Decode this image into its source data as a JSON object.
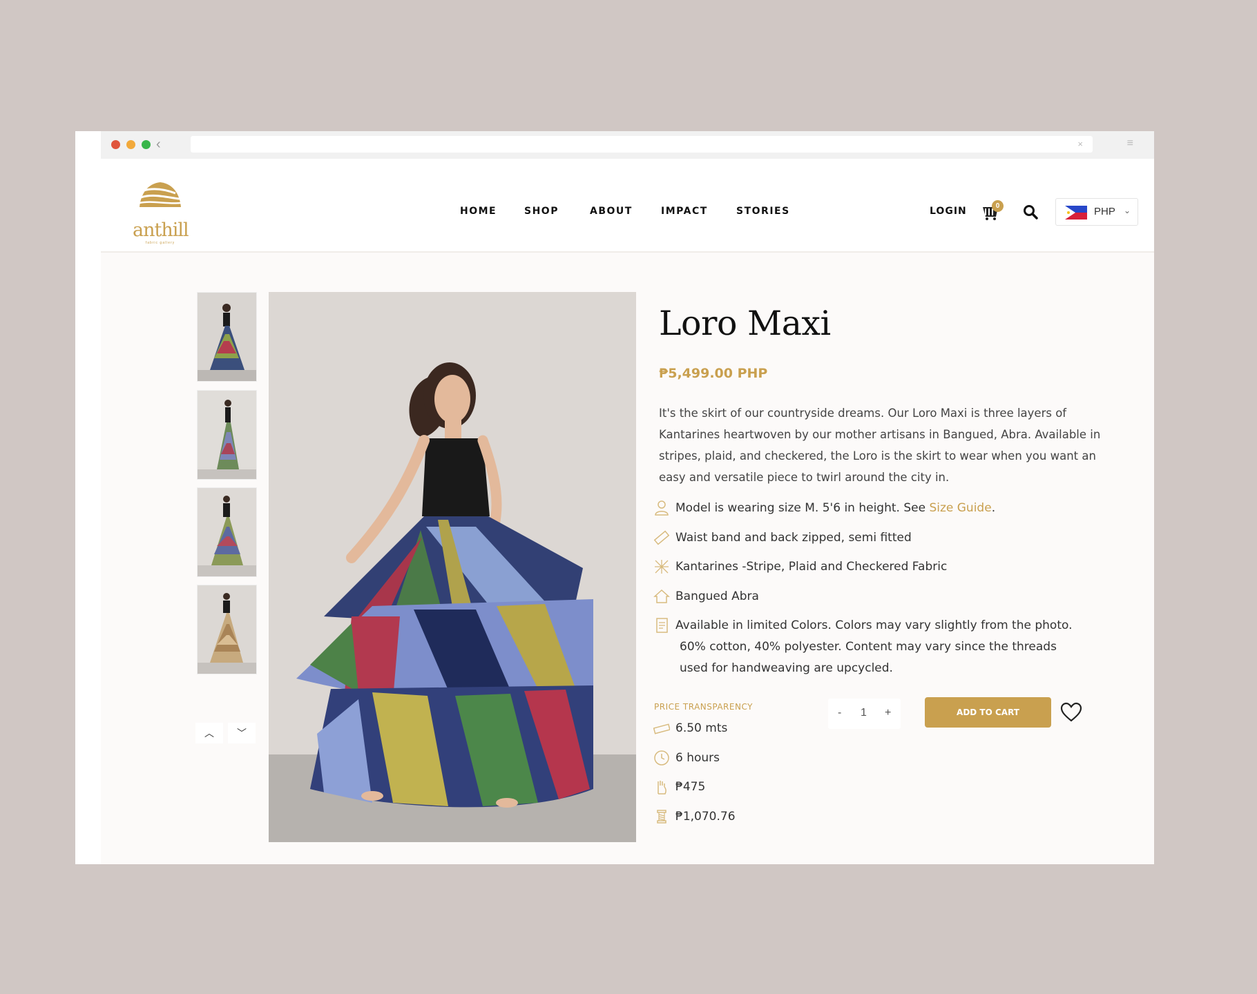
{
  "browser": {
    "back_glyph": "‹",
    "close_glyph": "×",
    "menu_glyph": "≡"
  },
  "brand": {
    "logo_text": "anthill",
    "logo_sub": "fabric gallery",
    "accent_color": "#c9a04f"
  },
  "nav": {
    "items": [
      "HOME",
      "SHOP",
      "ABOUT",
      "IMPACT",
      "STORIES"
    ],
    "login": "LOGIN",
    "cart_count": "0",
    "currency": "PHP",
    "caret": "⌄"
  },
  "gallery": {
    "thumbnail_count": 4,
    "up_glyph": "︿",
    "down_glyph": "﹀"
  },
  "product": {
    "title": "Loro Maxi",
    "price": "₱5,499.00 PHP",
    "description": "It's the skirt of our countryside dreams. Our Loro Maxi is three layers of Kantarines heartwoven by our mother artisans in Bangued, Abra. Available in stripes, plaid, and checkered, the Loro is the skirt to wear when you want an easy and versatile piece to twirl around the city in.",
    "features": {
      "model": "Model is wearing size M. 5'6 in height. See",
      "size_guide": "Size Guide",
      "period": ".",
      "fit": "Waist band and back zipped, semi fitted",
      "fabric": "Kantarines -Stripe, Plaid and Checkered Fabric",
      "origin": "Bangued Abra",
      "colors_line1": "Available in limited Colors. Colors may vary slightly from the photo.",
      "colors_line2": "60% cotton, 40% polyester. Content may vary since the threads",
      "colors_line3": "used for handweaving are upcycled."
    },
    "price_transparency": {
      "label": "PRICE TRANSPARENCY",
      "fabric_length": "6.50 mts",
      "time": "6 hours",
      "labor": "₱475",
      "materials": "₱1,070.76"
    },
    "quantity": {
      "minus": "-",
      "value": "1",
      "plus": "+"
    },
    "add_to_cart": "ADD TO CART"
  }
}
